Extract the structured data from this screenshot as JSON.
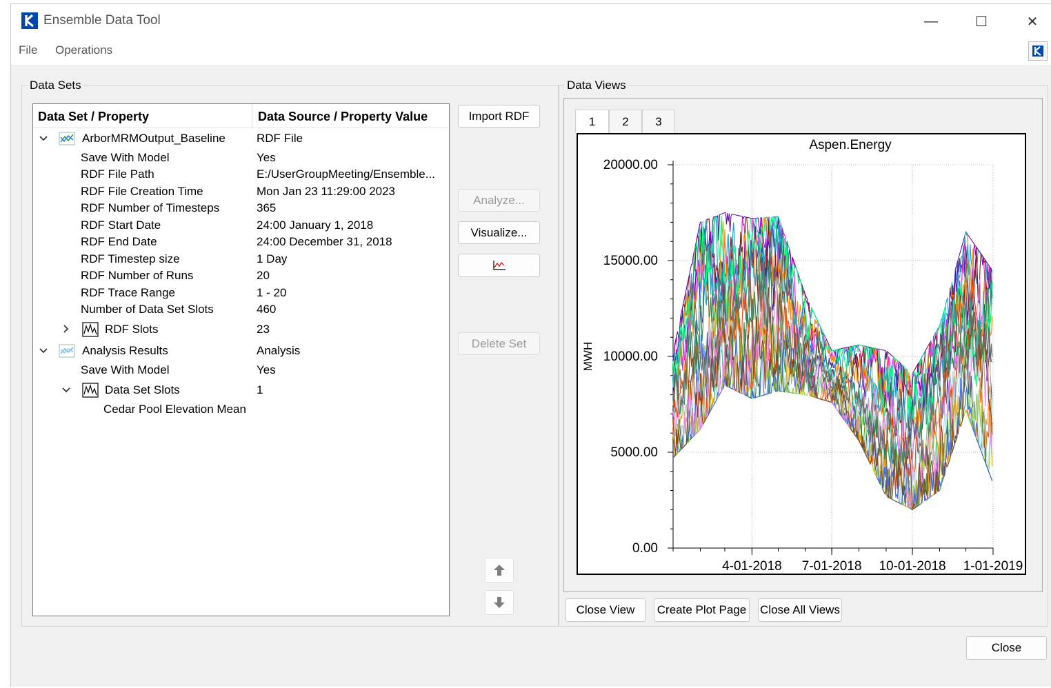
{
  "window": {
    "title": "Ensemble Data Tool",
    "controls": {
      "minimize": "—",
      "maximize": "☐",
      "close": "✕"
    }
  },
  "menu": {
    "items": [
      "File",
      "Operations"
    ]
  },
  "data_sets": {
    "group_title": "Data Sets",
    "columns": [
      "Data Set / Property",
      "Data Source / Property Value"
    ],
    "rows": [
      {
        "label": "ArborMRMOutput_Baseline",
        "value": "RDF File"
      },
      {
        "label": "Save With Model",
        "value": "Yes"
      },
      {
        "label": "RDF File Path",
        "value": "E:/UserGroupMeeting/Ensemble..."
      },
      {
        "label": "RDF File Creation Time",
        "value": "Mon Jan 23 11:29:00 2023"
      },
      {
        "label": "RDF Number of Timesteps",
        "value": "365"
      },
      {
        "label": "RDF Start Date",
        "value": "24:00 January 1, 2018"
      },
      {
        "label": "RDF End Date",
        "value": "24:00 December 31, 2018"
      },
      {
        "label": "RDF Timestep size",
        "value": "1 Day"
      },
      {
        "label": "RDF Number of Runs",
        "value": "20"
      },
      {
        "label": "RDF Trace Range",
        "value": "1 - 20"
      },
      {
        "label": "Number of Data Set Slots",
        "value": "460"
      },
      {
        "label": "RDF Slots",
        "value": "23"
      },
      {
        "label": "Analysis Results",
        "value": "Analysis"
      },
      {
        "label": "Save With Model",
        "value": "Yes"
      },
      {
        "label": "Data Set Slots",
        "value": "1"
      },
      {
        "label": "Cedar Pool Elevation Mean",
        "value": ""
      }
    ],
    "buttons": {
      "import": "Import RDF",
      "analyze": "Analyze...",
      "visualize": "Visualize...",
      "delete": "Delete Set"
    }
  },
  "data_views": {
    "group_title": "Data Views",
    "tabs": [
      "1",
      "2",
      "3"
    ],
    "buttons": {
      "close_view": "Close View",
      "create_plot_page": "Create Plot Page",
      "close_all_views": "Close All Views"
    }
  },
  "close_button": "Close",
  "colors": {
    "accent": "#0047ab",
    "window_bg": "#f0f0f0"
  },
  "chart_data": {
    "type": "line",
    "title": "Aspen.Energy",
    "ylabel": "MWH",
    "xlabel": "",
    "ylim": [
      0,
      20000
    ],
    "xlim": [
      "2018-01-01",
      "2019-01-01"
    ],
    "y_ticks": [
      "20000.00",
      "15000.00",
      "10000.00",
      "5000.00",
      "0.00"
    ],
    "x_ticks": [
      "4-01-2018",
      "7-01-2018",
      "10-01-2018",
      "1-01-2019"
    ],
    "grid": true,
    "n_traces": 20,
    "series_colors": [
      "#2d2da8",
      "#22b14c",
      "#ff00ff",
      "#1a9fd6",
      "#c0c0c0",
      "#8b1a1a",
      "#ff8c00",
      "#6a0dad",
      "#9acd32",
      "#20b2aa",
      "#ff4500",
      "#3a5f5f",
      "#b0e0e6",
      "#daa520",
      "#4169e1",
      "#ee82ee",
      "#2e8b57",
      "#00ff7f",
      "#8b4513",
      "#696969"
    ],
    "envelope": [
      {
        "date": "2018-01-01",
        "min": 4700,
        "max": 10200
      },
      {
        "date": "2018-02-01",
        "min": 6200,
        "max": 17000
      },
      {
        "date": "2018-03-01",
        "min": 8500,
        "max": 17500
      },
      {
        "date": "2018-04-01",
        "min": 7800,
        "max": 17200
      },
      {
        "date": "2018-05-01",
        "min": 8200,
        "max": 17300
      },
      {
        "date": "2018-06-01",
        "min": 8000,
        "max": 13200
      },
      {
        "date": "2018-07-01",
        "min": 7600,
        "max": 10300
      },
      {
        "date": "2018-08-01",
        "min": 5600,
        "max": 10600
      },
      {
        "date": "2018-09-01",
        "min": 2700,
        "max": 10300
      },
      {
        "date": "2018-10-01",
        "min": 2000,
        "max": 9100
      },
      {
        "date": "2018-11-01",
        "min": 3000,
        "max": 11600
      },
      {
        "date": "2018-12-01",
        "min": 7200,
        "max": 16500
      },
      {
        "date": "2018-12-31",
        "min": 3500,
        "max": 14500
      }
    ]
  }
}
